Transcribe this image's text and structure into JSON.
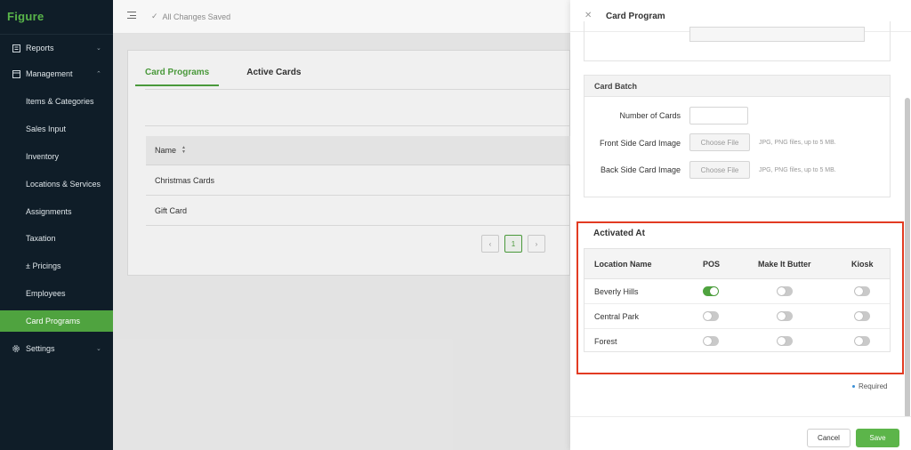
{
  "app": {
    "brand": "Figure"
  },
  "sidebar": {
    "items": [
      {
        "label": "Reports",
        "icon": "report-icon",
        "chevron": "⌄"
      },
      {
        "label": "Management",
        "icon": "management-icon",
        "chevron": "⌃"
      },
      {
        "label": "Items & Categories"
      },
      {
        "label": "Sales Input"
      },
      {
        "label": "Inventory"
      },
      {
        "label": "Locations & Services"
      },
      {
        "label": "Assignments"
      },
      {
        "label": "Taxation"
      },
      {
        "label": "± Pricings"
      },
      {
        "label": "Employees"
      },
      {
        "label": "Card Programs",
        "active": true
      },
      {
        "label": "Settings",
        "icon": "gear-icon",
        "chevron": "⌄"
      }
    ]
  },
  "topbar": {
    "saved_text": "All Changes Saved"
  },
  "main": {
    "tabs": [
      {
        "label": "Card Programs",
        "active": true
      },
      {
        "label": "Active Cards"
      }
    ],
    "table": {
      "header": "Name",
      "rows": [
        "Christmas Cards",
        "Gift Card"
      ]
    },
    "pagination": {
      "prev": "‹",
      "current": "1",
      "next": "›"
    }
  },
  "drawer": {
    "title": "Card Program",
    "batch": {
      "title": "Card Batch",
      "number_label": "Number of Cards",
      "front_label": "Front Side Card Image",
      "back_label": "Back Side Card Image",
      "choose_label": "Choose File",
      "hint": "JPG, PNG files, up to 5 MB."
    },
    "activated": {
      "title": "Activated At",
      "columns": [
        "Location Name",
        "POS",
        "Make It Butter",
        "Kiosk"
      ],
      "rows": [
        {
          "location": "Beverly Hills",
          "pos": true,
          "butter": false,
          "kiosk": false
        },
        {
          "location": "Central Park",
          "pos": false,
          "butter": false,
          "kiosk": false
        },
        {
          "location": "Forest",
          "pos": false,
          "butter": false,
          "kiosk": false
        }
      ]
    },
    "required_text": "Required",
    "cancel_label": "Cancel",
    "save_label": "Save"
  },
  "colors": {
    "accent": "#4fa33f",
    "sidebar_bg": "#0f1d28",
    "highlight": "#e23b22"
  }
}
